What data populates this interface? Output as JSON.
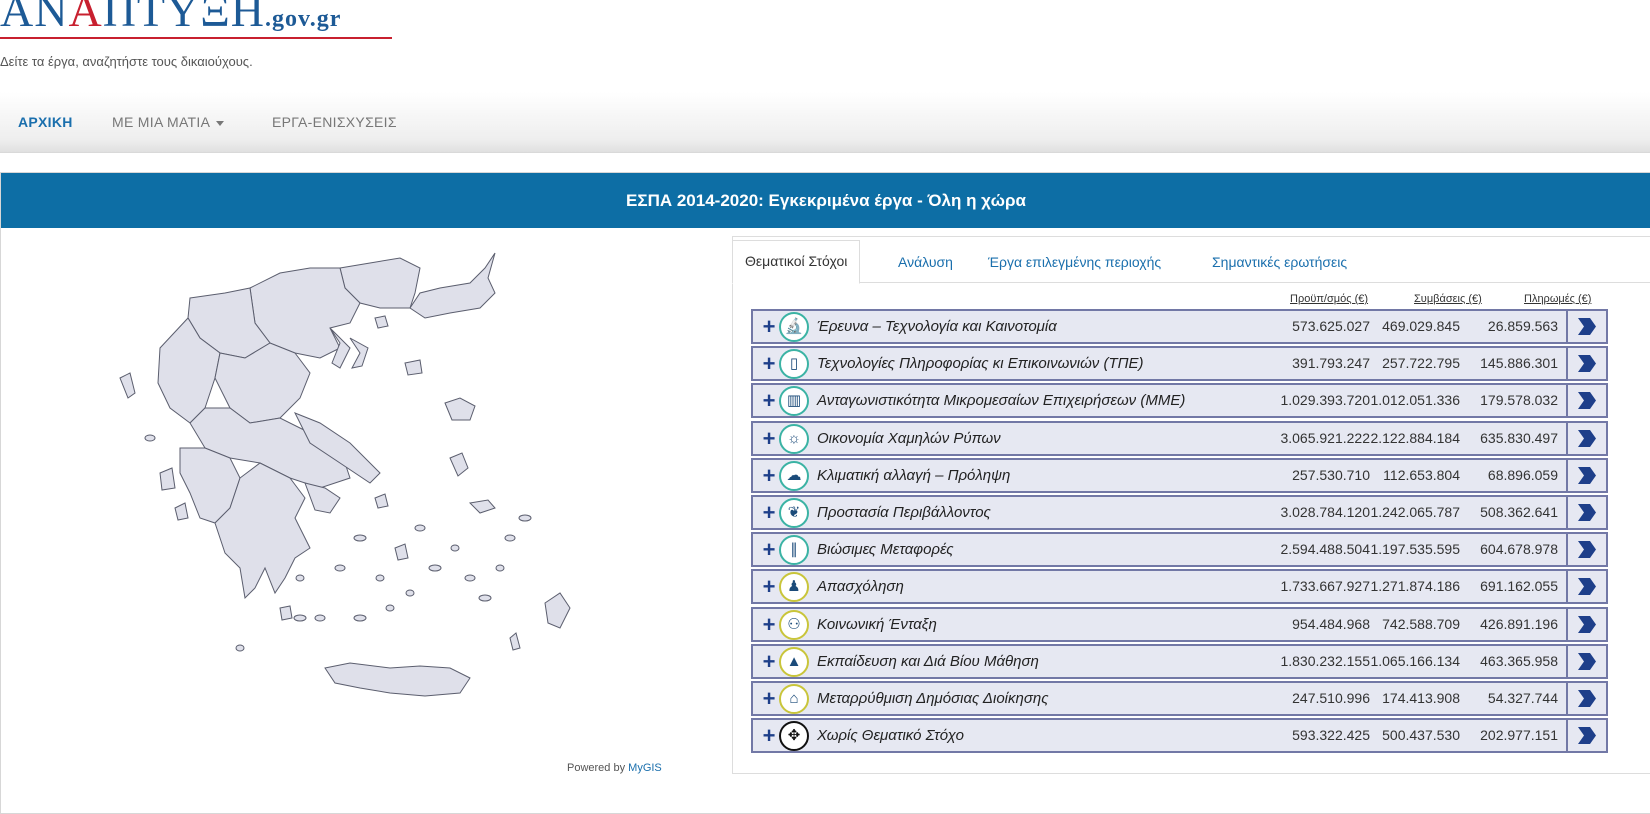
{
  "header": {
    "logo_text_1": "ΑΝ",
    "logo_text_red": "Α",
    "logo_text_2": "ΠΤΥΞΗ",
    "logo_domain": ".gov.gr",
    "tagline": "Δείτε τα έργα, αναζητήστε τους δικαιούχους."
  },
  "nav": {
    "items": [
      {
        "label": "ΑΡΧΙΚΗ",
        "active": true
      },
      {
        "label": "ΜΕ ΜΙΑ ΜΑΤΙΑ"
      },
      {
        "label": "ΕΡΓΑ-ΕΝΙΣΧΥΣΕΙΣ"
      }
    ]
  },
  "panel": {
    "title": "ΕΣΠΑ 2014-2020: Εγκεκριμένα έργα - Όλη η χώρα"
  },
  "map": {
    "powered_by": "Powered by",
    "powered_link": "MyGIS",
    "fill_color": "#dfe0ea",
    "stroke_color": "#5b5e6e"
  },
  "tabs": [
    {
      "label": "Θεματικοί Στόχοι",
      "active": true
    },
    {
      "label": "Ανάλυση"
    },
    {
      "label": "Έργα επιλεγμένης περιοχής"
    },
    {
      "label": "Σημαντικές ερωτήσεις"
    }
  ],
  "table": {
    "columns": [
      "Προϋπ/σμός (€)",
      "Συμβάσεις (€)",
      "Πληρωμές (€)"
    ],
    "rows": [
      {
        "label": "Έρευνα – Τεχνολογία και Καινοτομία",
        "budget": "573.625.027",
        "contracts": "469.029.845",
        "payments": "26.859.563",
        "icon": "microscope-icon",
        "glyph": "🔬"
      },
      {
        "label": "Τεχνολογίες Πληροφορίας κι Επικοινωνιών (ΤΠΕ)",
        "budget": "391.793.247",
        "contracts": "257.722.795",
        "payments": "145.886.301",
        "icon": "tablet-icon",
        "glyph": "▯"
      },
      {
        "label": "Ανταγωνιστικότητα Μικρομεσαίων Επιχειρήσεων (ΜΜΕ)",
        "budget": "1.029.393.720",
        "contracts": "1.012.051.336",
        "payments": "179.578.032",
        "icon": "factory-icon",
        "glyph": "▥"
      },
      {
        "label": "Οικονομία Χαμηλών Ρύπων",
        "budget": "3.065.921.222",
        "contracts": "2.122.884.184",
        "payments": "635.830.497",
        "icon": "lightbulb-icon",
        "glyph": "☼"
      },
      {
        "label": "Κλιματική αλλαγή – Πρόληψη",
        "budget": "257.530.710",
        "contracts": "112.653.804",
        "payments": "68.896.059",
        "icon": "cloud-icon",
        "glyph": "☁"
      },
      {
        "label": "Προστασία Περιβάλλοντος",
        "budget": "3.028.784.120",
        "contracts": "1.242.065.787",
        "payments": "508.362.641",
        "icon": "leaf-hand-icon",
        "glyph": "❦"
      },
      {
        "label": "Βιώσιμες Μεταφορές",
        "budget": "2.594.488.504",
        "contracts": "1.197.535.595",
        "payments": "604.678.978",
        "icon": "road-icon",
        "glyph": "∥"
      },
      {
        "label": "Απασχόληση",
        "budget": "1.733.667.927",
        "contracts": "1.271.874.186",
        "payments": "691.162.055",
        "icon": "worker-icon",
        "glyph": "♟",
        "color": "yellow"
      },
      {
        "label": "Κοινωνική Ένταξη",
        "budget": "954.484.968",
        "contracts": "742.588.709",
        "payments": "426.891.196",
        "icon": "people-icon",
        "glyph": "⚇",
        "color": "yellow"
      },
      {
        "label": "Εκπαίδευση και Διά Βίου Μάθηση",
        "budget": "1.830.232.155",
        "contracts": "1.065.166.134",
        "payments": "463.365.958",
        "icon": "graduation-cap-icon",
        "glyph": "▲",
        "color": "yellow"
      },
      {
        "label": "Μεταρρύθμιση Δημόσιας Διοίκησης",
        "budget": "247.510.996",
        "contracts": "174.413.908",
        "payments": "54.327.744",
        "icon": "government-building-icon",
        "glyph": "⌂",
        "color": "yellow"
      },
      {
        "label": "Χωρίς Θεματικό Στόχο",
        "budget": "593.322.425",
        "contracts": "500.437.530",
        "payments": "202.977.151",
        "icon": "arrows-icon",
        "glyph": "✥",
        "color": "black"
      }
    ]
  }
}
